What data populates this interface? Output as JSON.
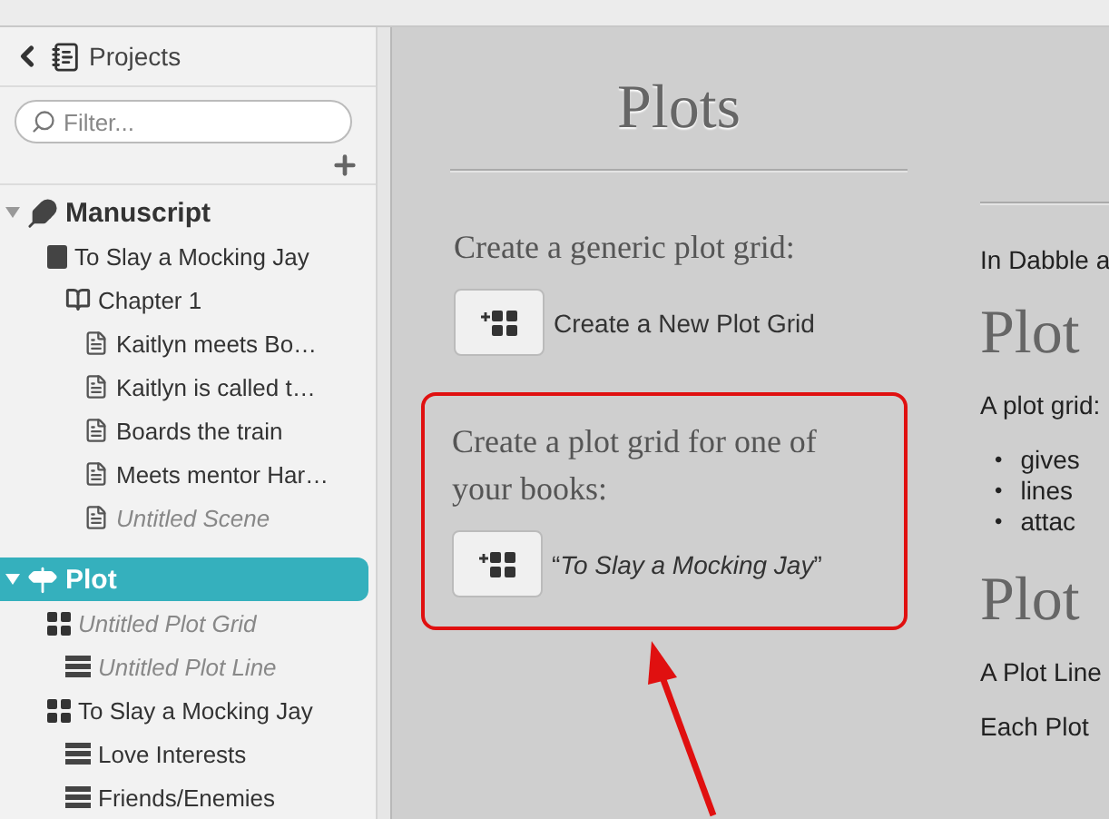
{
  "sidebar": {
    "header": {
      "title": "Projects"
    },
    "filter": {
      "placeholder": "Filter..."
    },
    "tree": [
      {
        "label": "Manuscript",
        "kind": "manuscript",
        "expanded": true,
        "selected": false,
        "untitled": false,
        "children": [
          {
            "label": "To Slay a Mocking Jay",
            "kind": "book",
            "selected": false,
            "untitled": false,
            "children": [
              {
                "label": "Chapter 1",
                "kind": "chapter",
                "selected": false,
                "untitled": false,
                "children": [
                  {
                    "label": "Kaitlyn meets Bo…",
                    "kind": "scene",
                    "selected": false,
                    "untitled": false
                  },
                  {
                    "label": "Kaitlyn is called t…",
                    "kind": "scene",
                    "selected": false,
                    "untitled": false
                  },
                  {
                    "label": "Boards the train",
                    "kind": "scene",
                    "selected": false,
                    "untitled": false
                  },
                  {
                    "label": "Meets mentor Har…",
                    "kind": "scene",
                    "selected": false,
                    "untitled": false
                  },
                  {
                    "label": "Untitled Scene",
                    "kind": "scene",
                    "selected": false,
                    "untitled": true
                  }
                ]
              }
            ]
          }
        ]
      },
      {
        "label": "Plot",
        "kind": "plot",
        "expanded": true,
        "selected": true,
        "untitled": false,
        "children": [
          {
            "label": "Untitled Plot Grid",
            "kind": "grid",
            "selected": false,
            "untitled": true,
            "children": [
              {
                "label": "Untitled Plot Line",
                "kind": "line",
                "selected": false,
                "untitled": true
              }
            ]
          },
          {
            "label": "To Slay a Mocking Jay",
            "kind": "grid",
            "selected": false,
            "untitled": false,
            "children": [
              {
                "label": "Love Interests",
                "kind": "line",
                "selected": false,
                "untitled": false
              },
              {
                "label": "Friends/Enemies",
                "kind": "line",
                "selected": false,
                "untitled": false
              }
            ]
          }
        ]
      }
    ]
  },
  "main": {
    "title": "Plots",
    "sections": [
      {
        "heading": "Create a generic plot grid:",
        "button_label": "Create a New Plot Grid",
        "italic": false,
        "highlighted": false
      },
      {
        "heading": "Create a plot grid for one of your books:",
        "button_label": "“*To Slay a Mocking Jay*”",
        "italic": false,
        "highlighted": true
      }
    ],
    "info": [
      {
        "kind": "para",
        "text": "In Dabble a"
      },
      {
        "kind": "heading",
        "text": "Plot"
      },
      {
        "kind": "para",
        "text": "A plot grid:"
      },
      {
        "kind": "bullets",
        "items": [
          {
            "marker": "•",
            "text": "gives"
          },
          {
            "marker": "•",
            "text": "lines"
          },
          {
            "marker": "•",
            "text": "attac"
          }
        ]
      },
      {
        "kind": "heading",
        "text": "Plot"
      },
      {
        "kind": "para",
        "text": "A Plot Line"
      },
      {
        "kind": "para",
        "text": "Each Plot"
      }
    ]
  }
}
